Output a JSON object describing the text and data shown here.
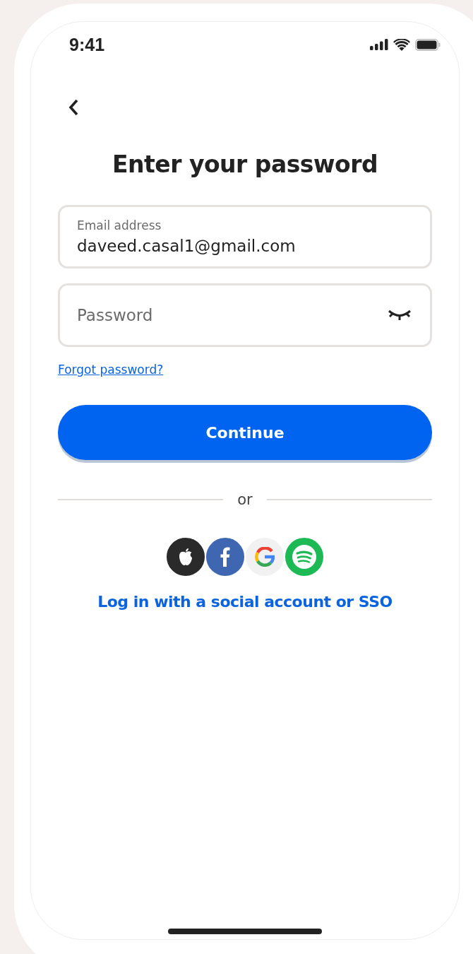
{
  "status_bar": {
    "time": "9:41"
  },
  "title": "Enter your password",
  "email_field": {
    "label": "Email address",
    "value": "daveed.casal1@gmail.com"
  },
  "password_field": {
    "placeholder": "Password",
    "visible": false
  },
  "forgot_link": "Forgot password?",
  "continue_button": "Continue",
  "divider": "or",
  "social_buttons": [
    {
      "kind": "apple"
    },
    {
      "kind": "facebook"
    },
    {
      "kind": "google"
    },
    {
      "kind": "spotify"
    }
  ],
  "sso_link": "Log in with a social account or SSO"
}
